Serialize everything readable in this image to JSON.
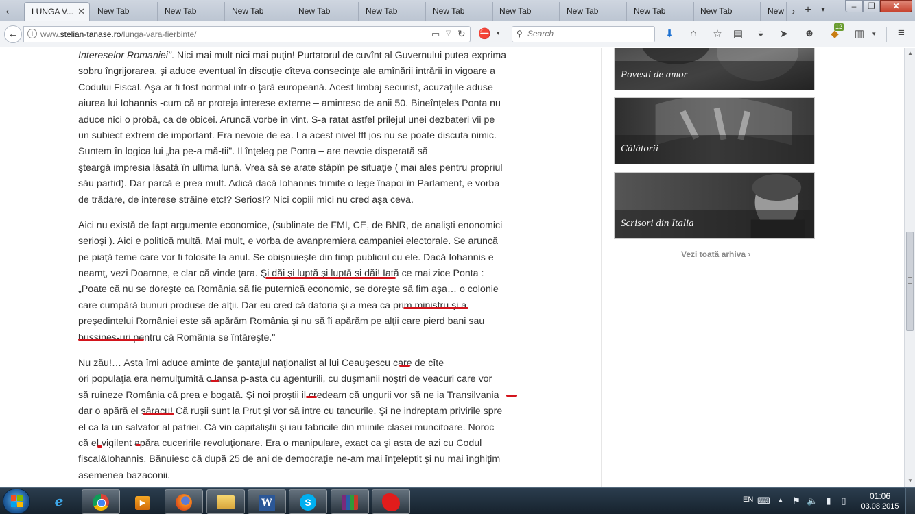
{
  "browser": {
    "tabs": [
      {
        "label": "LUNGA V...",
        "active": true
      },
      {
        "label": "New Tab"
      },
      {
        "label": "New Tab"
      },
      {
        "label": "New Tab"
      },
      {
        "label": "New Tab"
      },
      {
        "label": "New Tab"
      },
      {
        "label": "New Tab"
      },
      {
        "label": "New Tab"
      },
      {
        "label": "New Tab"
      },
      {
        "label": "New Tab"
      },
      {
        "label": "New Tab"
      },
      {
        "label": "New"
      }
    ],
    "tab_close": "✕",
    "new_tab": "+",
    "tab_list": "▾",
    "scroll_left": "‹",
    "scroll_right": "›",
    "window_buttons": {
      "minimize": "‒",
      "maximize": "❐",
      "close": "✕"
    },
    "url": {
      "prefix": "www.",
      "domain": "stelian-tanase.ro",
      "path": "/lunga-vara-fierbinte/"
    },
    "search_placeholder": "Search",
    "addon_badge": "12",
    "icons": {
      "back": "←",
      "globe": "i",
      "reader": "▭",
      "drop": "▽",
      "reload": "↻",
      "noscript": "⛔",
      "search": "⚲",
      "download": "⬇",
      "home": "⌂",
      "star": "☆",
      "bookmarks": "▤",
      "pocket": "◒",
      "send": "➤",
      "chat": "☻",
      "addon": "◆",
      "clipboard": "▥",
      "menu": "≡",
      "chevron": "▾"
    }
  },
  "article": {
    "p1": [
      "Intereselor Romaniei\". Nici mai mult nici mai puţin! Purtatorul de cuvînt al Guvernului putea exprima",
      "sobru îngrijorarea, şi aduce eventual în discuţie cîteva consecinţe ale amînării intrării in vigoare a",
      "Codului Fiscal. Aşa ar fi fost normal intr-o ţară europeană. Acest limbaj securist, acuzaţiile aduse",
      "aiurea lui Iohannis -cum că ar proteja interese externe – amintesc de anii 50. Bineînţeles Ponta nu",
      "aduce nici o probă, ca de obicei. Aruncă vorbe in vint. S-a ratat astfel prilejul unei dezbateri vii pe",
      "un subiect extrem de important. Era nevoie de ea. La acest nivel fff jos nu se poate discuta nimic.",
      "Suntem în logica lui „ba pe-a mă-tii\". Il înţeleg pe Ponta – are nevoie disperată să",
      "şteargă impresia lăsată în ultima lună. Vrea să se arate stăpîn pe situaţie ( mai ales pentru  propriul",
      "său partid). Dar parcă e prea mult. Adică dacă Iohannis trimite o lege înapoi în Parlament, e vorba",
      "de trădare, de interese străine etc!? Serios!? Nici copiii mici nu cred aşa ceva."
    ],
    "p2": [
      "Aici nu există de fapt argumente economice, (sublinate de FMI, CE, de BNR, de analişti enonomici",
      "serioşi ). Aici e politică multă. Mai mult, e vorba de avanpremiera campaniei electorale. Se aruncă",
      "pe piaţă teme care vor fi folosite la anul. Se obişnuieşte din timp publicul cu ele. Dacă Iohannis e",
      "neamţ, vezi Doamne, e clar că vinde ţara. Şi dăi şi luptă şi luptă şi dăi! Iată ce mai zice Ponta :",
      "„Poate că nu se doreşte ca România să fie puternică economic, se doreşte să fim aşa… o colonie",
      "care cumpără bunuri produse de alţii. Dar eu cred că datoria şi a mea ca prim ministru şi a",
      "preşedintelui României este să apărăm România şi nu să îi apărăm pe alţii care pierd bani sau",
      "bussines-uri pentru că România se întăreşte.\""
    ],
    "p3": [
      "Nu zău!… Asta îmi aduce aminte de şantajul naţionalist al lui Ceauşescu care de cîte",
      "ori populaţia era nemulţumită o lansa p-asta cu agenturili, cu duşmanii noştri de veacuri care vor",
      "să ruineze România că prea e bogată. Şi noi proştii il credeam că ungurii vor să ne ia Transilvania",
      "dar o apără el săracu! Că ruşii sunt la Prut şi vor să intre cu tancurile. Şi ne indreptam privirile spre",
      "el ca la un salvator al patriei. Că vin capitaliştii şi iau fabricile din miinile clasei muncitoare. Noroc",
      "că el vigilent apăra cuceririle revoluţionare. Era o manipulare, exact ca şi asta de azi cu Codul",
      "fiscal&Iohannis. Bănuiesc că după 25 de ani de democraţie ne-am mai înţeleptit şi nu mai înghiţim",
      "asemenea bazaconii."
    ]
  },
  "sidebar": {
    "cards": [
      {
        "label": "Povesti de amor"
      },
      {
        "label": "Călătorii"
      },
      {
        "label": "Scrisori din Italia"
      }
    ],
    "archive_link": "Vezi toată arhiva ›"
  },
  "scrollbar": {
    "up": "▲",
    "down": "▼"
  },
  "taskbar": {
    "ie_label": "e",
    "media_label": "▶",
    "word_label": "W",
    "skype_label": "S",
    "language": "EN",
    "tray_icons": {
      "keyboard": "⌨",
      "up": "▲",
      "flag": "⚑",
      "volume": "🔈",
      "network": "▮",
      "power": "▯"
    },
    "clock": {
      "time": "01:06",
      "date": "03.08.2015"
    }
  },
  "colors": {
    "underline": "#d3141c",
    "text": "#333333",
    "tabstrip": "#c6cedb"
  }
}
